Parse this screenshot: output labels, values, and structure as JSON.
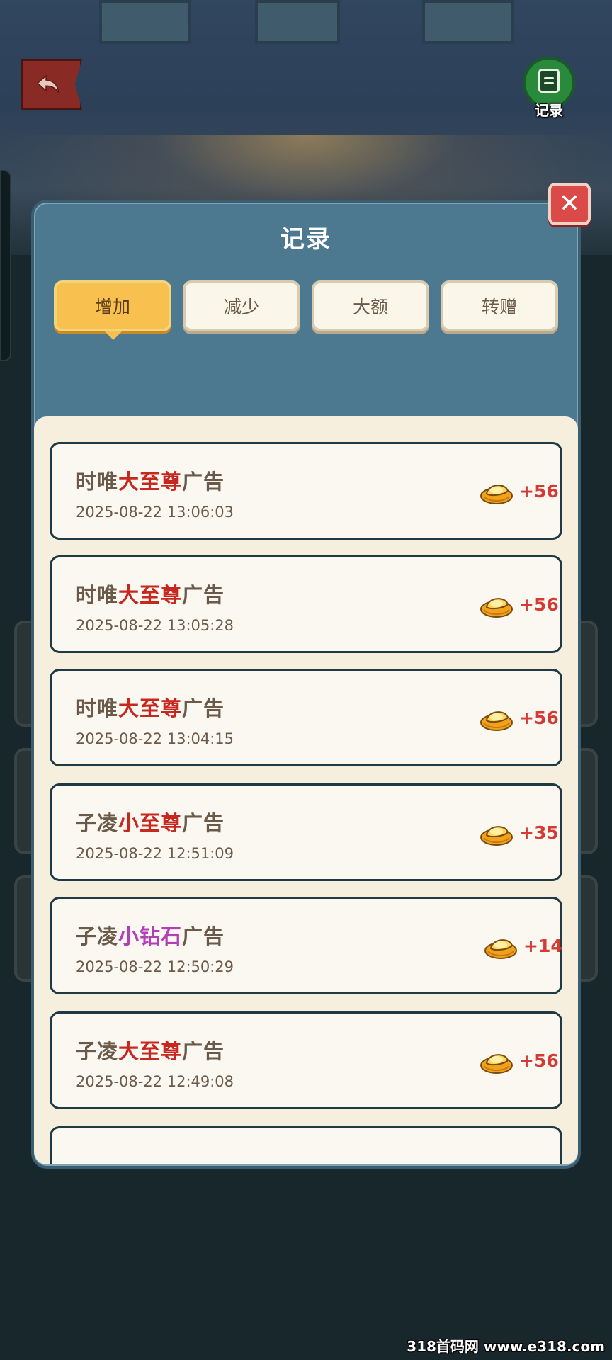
{
  "header": {
    "record_button_label": "记录"
  },
  "modal": {
    "title": "记录",
    "tabs": [
      {
        "label": "增加",
        "active": true
      },
      {
        "label": "减少",
        "active": false
      },
      {
        "label": "大额",
        "active": false
      },
      {
        "label": "转赠",
        "active": false
      }
    ]
  },
  "records": [
    {
      "prefix": "时唯",
      "highlight": "大至尊",
      "highlight_color": "red",
      "suffix": "广告",
      "time": "2025-08-22 13:06:03",
      "amount": "+56"
    },
    {
      "prefix": "时唯",
      "highlight": "大至尊",
      "highlight_color": "red",
      "suffix": "广告",
      "time": "2025-08-22 13:05:28",
      "amount": "+56"
    },
    {
      "prefix": "时唯",
      "highlight": "大至尊",
      "highlight_color": "red",
      "suffix": "广告",
      "time": "2025-08-22 13:04:15",
      "amount": "+56"
    },
    {
      "prefix": "子凌",
      "highlight": "小至尊",
      "highlight_color": "red",
      "suffix": "广告",
      "time": "2025-08-22 12:51:09",
      "amount": "+35"
    },
    {
      "prefix": "子凌",
      "highlight": "小钻石",
      "highlight_color": "purple",
      "suffix": "广告",
      "time": "2025-08-22 12:50:29",
      "amount": "+14"
    },
    {
      "prefix": "子凌",
      "highlight": "大至尊",
      "highlight_color": "red",
      "suffix": "广告",
      "time": "2025-08-22 12:49:08",
      "amount": "+56"
    }
  ],
  "watermark": "318首码网 www.e318.com",
  "icons": {
    "back": "back-arrow-icon",
    "record": "notebook-icon",
    "close": "close-icon",
    "currency": "gold-ingot-icon"
  },
  "colors": {
    "highlight_red": "#c8271f",
    "highlight_purple": "#b43db8",
    "amount": "#d43b34",
    "tab_active": "#f8c04f"
  }
}
